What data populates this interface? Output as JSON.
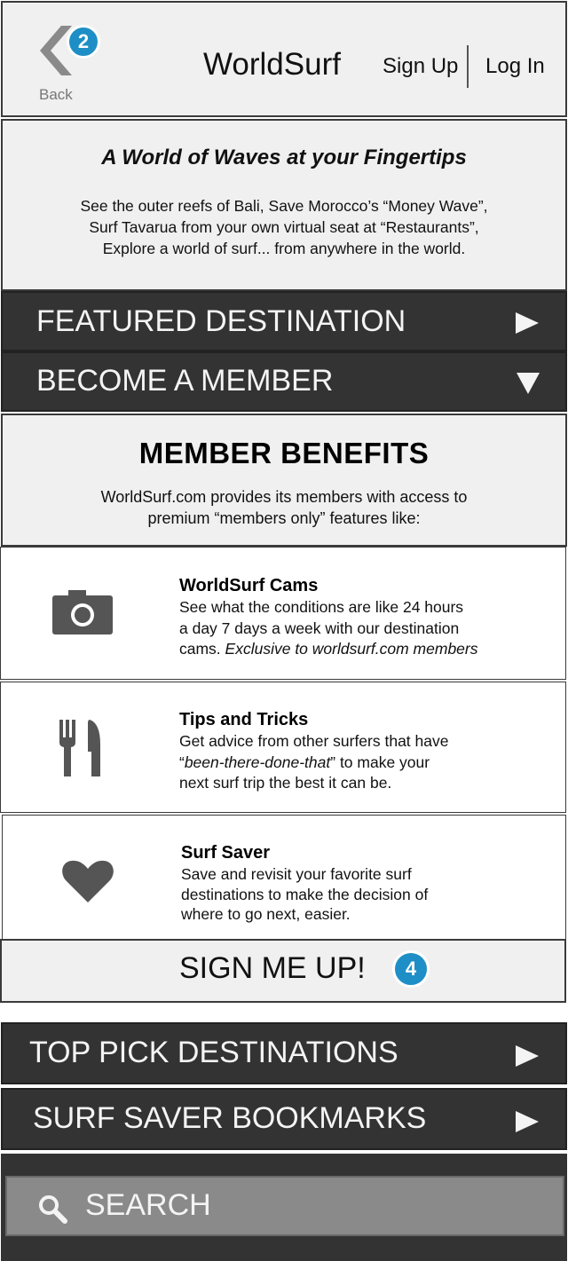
{
  "header": {
    "back_label": "Back",
    "badge_back": "2",
    "app_title": "WorldSurf",
    "signup": "Sign Up",
    "login": "Log In"
  },
  "intro": {
    "title": "A World of Waves at your Fingertips",
    "lines": [
      "See the outer reefs of Bali, Save Morocco’s “Money Wave”,",
      "Surf Tavarua from your own virtual seat at “Restaurants”,",
      "Explore a world of surf... from anywhere in the world."
    ]
  },
  "menu": {
    "featured": "FEATURED  DESTINATION",
    "member": "BECOME  A  MEMBER",
    "top_pick": "TOP PICK DESTINATIONS",
    "saver": "SURF SAVER BOOKMARKS"
  },
  "benefits": {
    "title": "MEMBER BENEFITS",
    "subtitle_lines": [
      "WorldSurf.com provides its members with access to",
      "premium “members only” features like:"
    ],
    "items": [
      {
        "title": "WorldSurf Cams",
        "lines": [
          "See what the conditions are like 24 hours",
          "a day 7 days a week with our destination"
        ],
        "line3_plain": "cams. ",
        "line3_italic": "Exclusive to worldsurf.com members",
        "icon": "camera-icon"
      },
      {
        "title": "Tips and Tricks",
        "line1": "Get advice from other surfers that have",
        "line2_quote_open": "“",
        "line2_italic": "been-there-done-that",
        "line2_rest": "” to make your",
        "line3": "next surf trip the best it can be.",
        "icon": "fork-knife-icon"
      },
      {
        "title": "Surf Saver",
        "lines": [
          "Save and revisit your favorite surf",
          "destinations to make the decision of",
          "where to go next, easier."
        ],
        "icon": "heart-icon"
      }
    ]
  },
  "signup_cta": {
    "label": "SIGN ME UP!",
    "badge": "4"
  },
  "search": {
    "label": "SEARCH"
  },
  "colors": {
    "dark_bar": "#333333",
    "light_panel": "#f0f0f0",
    "badge": "#1e8fc6",
    "icon_gray": "#555555",
    "search_field": "#8a8a8a"
  }
}
